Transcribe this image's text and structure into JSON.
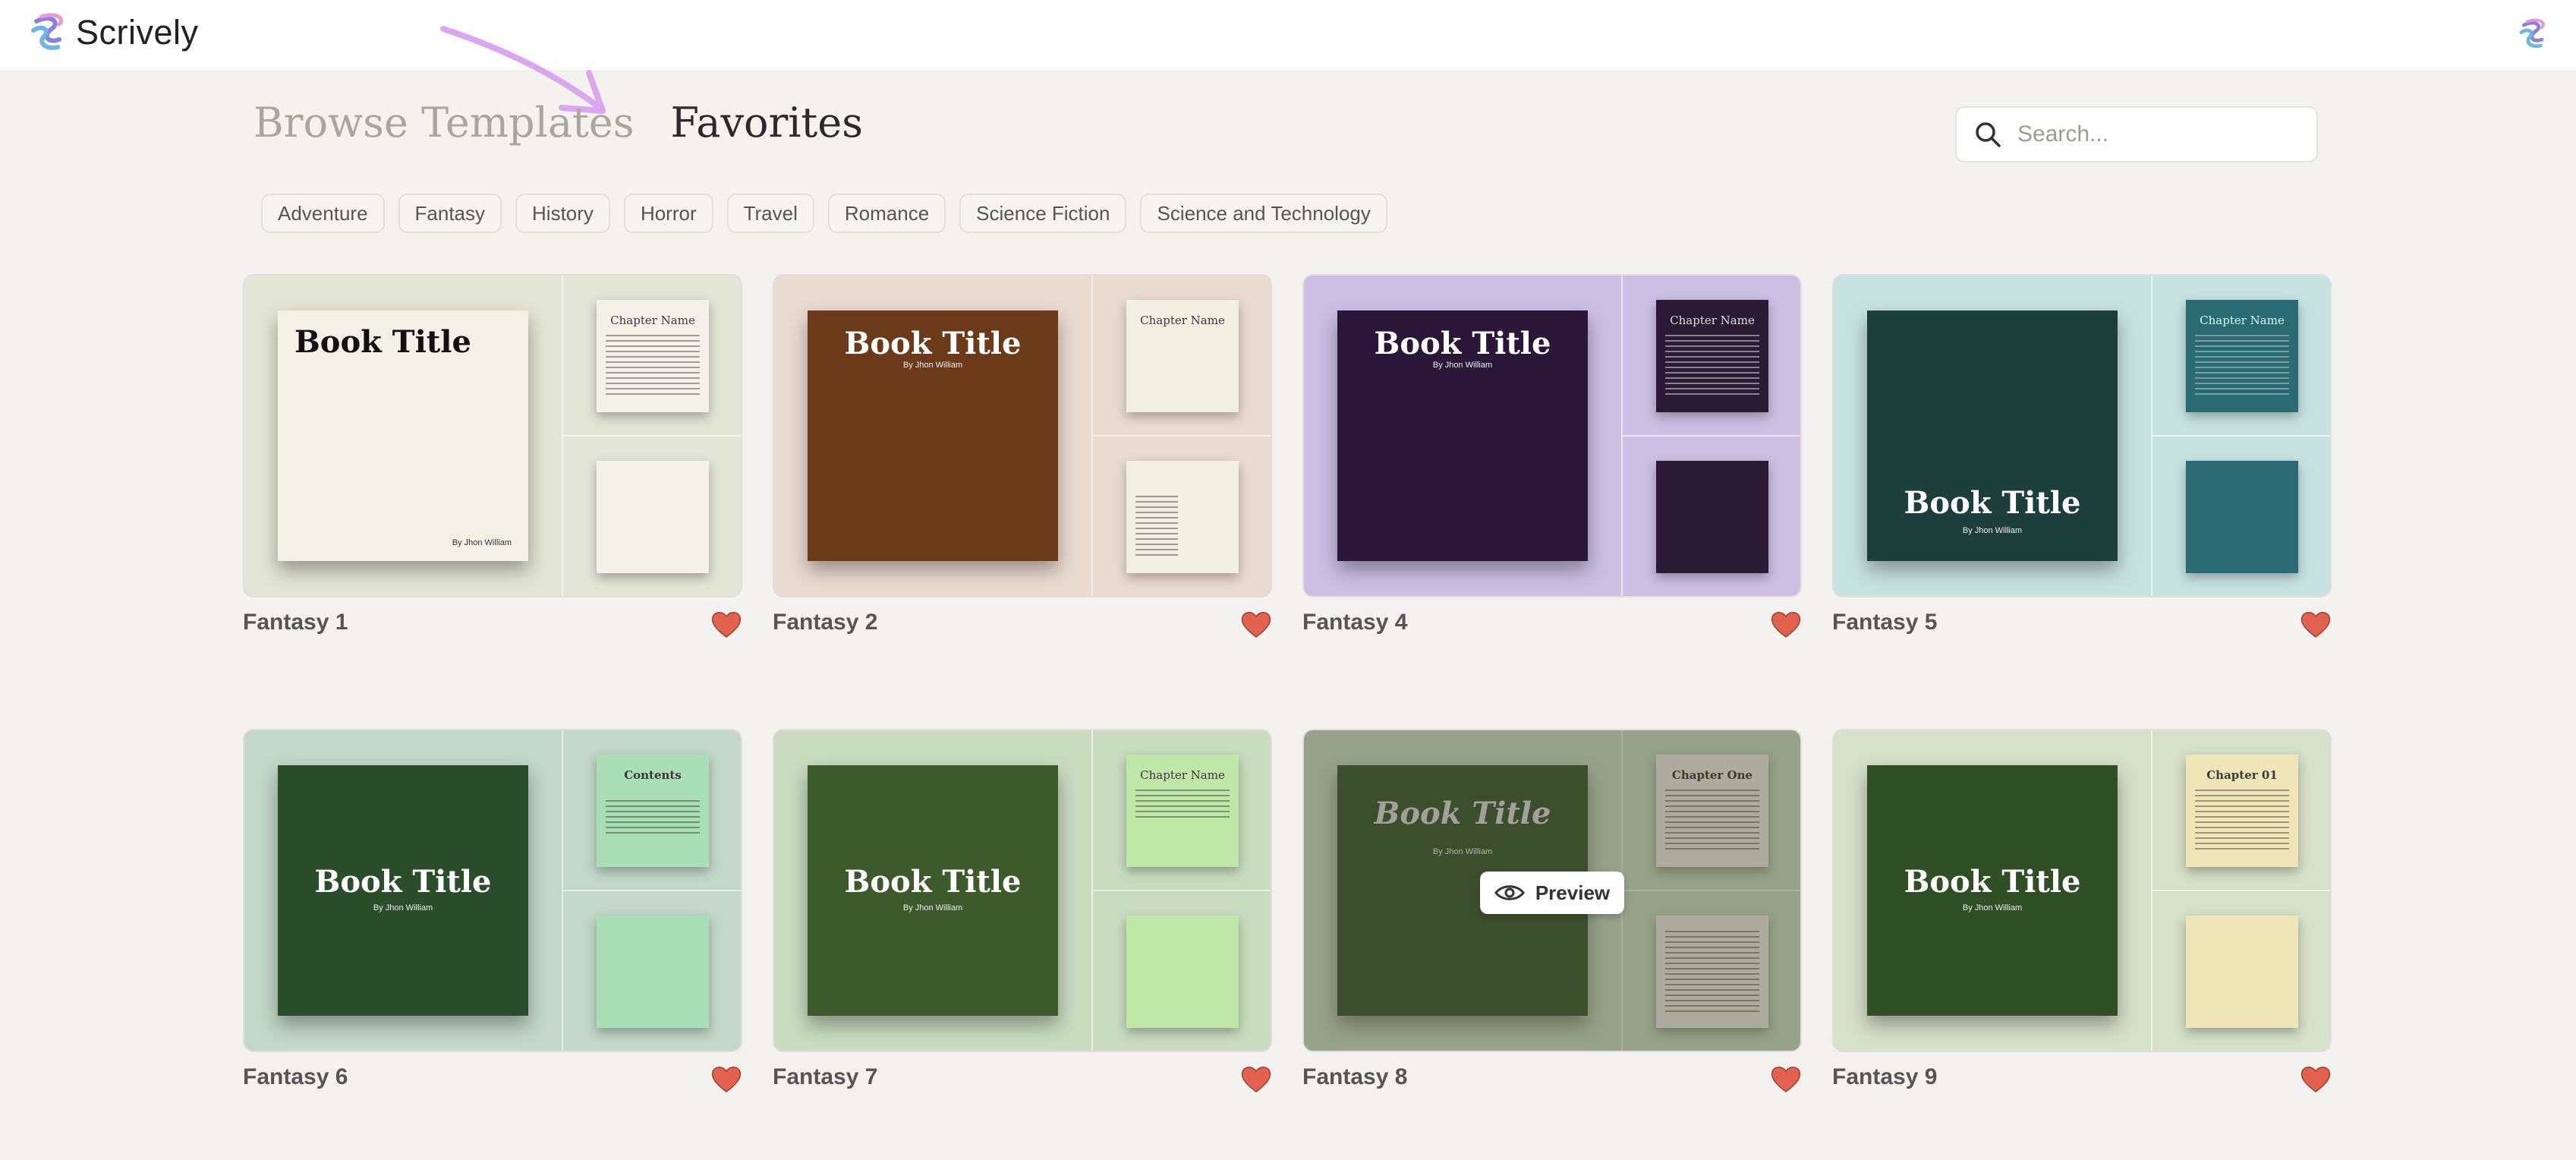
{
  "app": {
    "name": "Scrively"
  },
  "tabs": {
    "browse": "Browse Templates",
    "favorites": "Favorites"
  },
  "search": {
    "placeholder": "Search..."
  },
  "categories": [
    "Adventure",
    "Fantasy",
    "History",
    "Horror",
    "Travel",
    "Romance",
    "Science Fiction",
    "Science and Technology"
  ],
  "preview_label": "Preview",
  "cards": [
    {
      "name": "Fantasy 1",
      "cover_title": "Book Title",
      "author": "By Jhon William",
      "page_a": "Chapter Name",
      "bg": "#e3e5d6",
      "cover_color": "#f2f1e6",
      "page_color": "#f4f2e8"
    },
    {
      "name": "Fantasy 2",
      "cover_title": "Book Title",
      "author": "By Jhon William",
      "page_a": "Chapter Name",
      "bg": "#eadbd1",
      "cover_color": "#6b3a18",
      "page_color": "#f1efe2"
    },
    {
      "name": "Fantasy 4",
      "cover_title": "Book Title",
      "author": "By Jhon William",
      "page_a": "Chapter Name",
      "bg": "#cbbfe4",
      "cover_color": "#2a1636",
      "page_color": "#2b1a33"
    },
    {
      "name": "Fantasy 5",
      "cover_title": "Book Title",
      "author": "By Jhon William",
      "page_a": "Chapter Name",
      "bg": "#c7e3e1",
      "cover_color": "#1c3f3c",
      "page_color": "#2a6a73"
    },
    {
      "name": "Fantasy 6",
      "cover_title": "Book Title",
      "author": "By Jhon William",
      "page_a": "Contents",
      "bg": "#c3d8c8",
      "cover_color": "#2b4e2a",
      "page_color": "#a9dfb5"
    },
    {
      "name": "Fantasy 7",
      "cover_title": "Book Title",
      "author": "By Jhon William",
      "page_a": "Chapter Name",
      "bg": "#c9dcc0",
      "cover_color": "#3d5a2a",
      "page_color": "#bfe7a8"
    },
    {
      "name": "Fantasy 8",
      "cover_title": "Book Title",
      "author": "By Jhon William",
      "page_a": "Chapter One",
      "bg": "#c7d9bd",
      "cover_color": "#3c5a30",
      "page_color": "#e9e6dc"
    },
    {
      "name": "Fantasy 9",
      "cover_title": "Book Title",
      "author": "By Jhon William",
      "page_a": "Chapter 01",
      "bg": "#d6e1c9",
      "cover_color": "#2f4f24",
      "page_color": "#efe6b8"
    }
  ],
  "colors": {
    "heart": "#e2614f",
    "arrow": "#d9a6f0"
  }
}
